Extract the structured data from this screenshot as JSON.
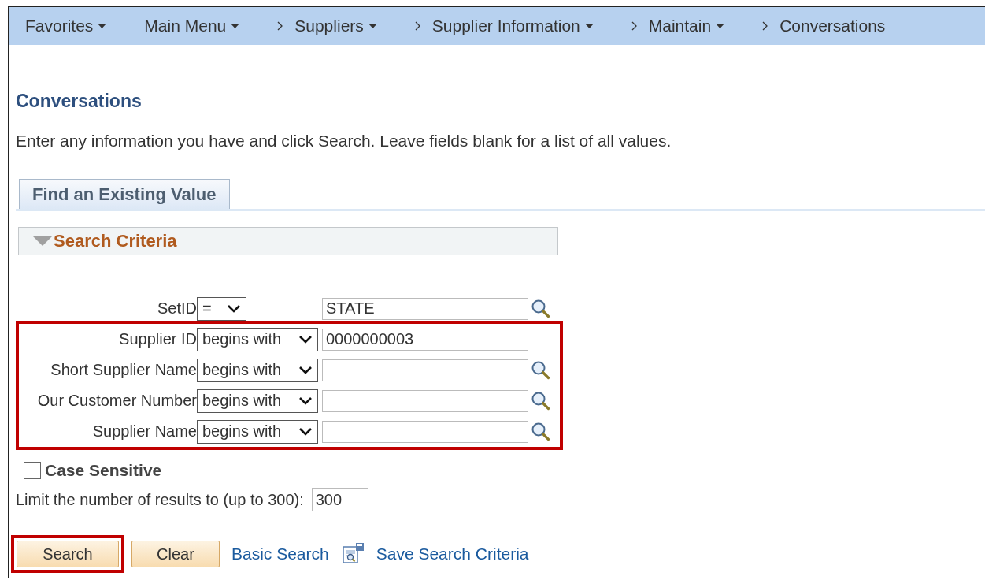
{
  "nav": [
    {
      "label": "Favorites",
      "dropdown": true,
      "separator_before": false
    },
    {
      "label": "Main Menu",
      "dropdown": true,
      "separator_before": false
    },
    {
      "label": "Suppliers",
      "dropdown": true,
      "separator_before": true
    },
    {
      "label": "Supplier Information",
      "dropdown": true,
      "separator_before": true
    },
    {
      "label": "Maintain",
      "dropdown": true,
      "separator_before": true
    },
    {
      "label": "Conversations",
      "dropdown": false,
      "separator_before": true
    }
  ],
  "page_title": "Conversations",
  "instructions": "Enter any information you have and click Search. Leave fields blank for a list of all values.",
  "tabs": [
    {
      "label": "Find an Existing Value",
      "selected": true
    }
  ],
  "section": {
    "title": "Search Criteria",
    "expanded": true
  },
  "fields": [
    {
      "label": "SetID",
      "operator": "=",
      "value": "STATE",
      "lookup": true,
      "highlighted": false
    },
    {
      "label": "Supplier ID",
      "operator": "begins with",
      "value": "0000000003",
      "lookup": false,
      "highlighted": true
    },
    {
      "label": "Short Supplier Name",
      "operator": "begins with",
      "lookup": true,
      "highlighted": true
    },
    {
      "label": "Our Customer Number",
      "operator": "begins with",
      "lookup": true,
      "highlighted": true
    },
    {
      "label": "Supplier Name",
      "operator": "begins with",
      "lookup": true,
      "highlighted": true
    }
  ],
  "case_sensitive": {
    "label": "Case Sensitive",
    "checked": false
  },
  "limit": {
    "label": "Limit the number of results to (up to 300):",
    "value": "300"
  },
  "buttons": [
    {
      "label": "Search",
      "highlighted": true
    },
    {
      "label": "Clear",
      "highlighted": false
    }
  ],
  "links": [
    {
      "label": "Basic Search",
      "icon": false
    },
    {
      "label": "Save Search Criteria",
      "icon": true
    }
  ]
}
